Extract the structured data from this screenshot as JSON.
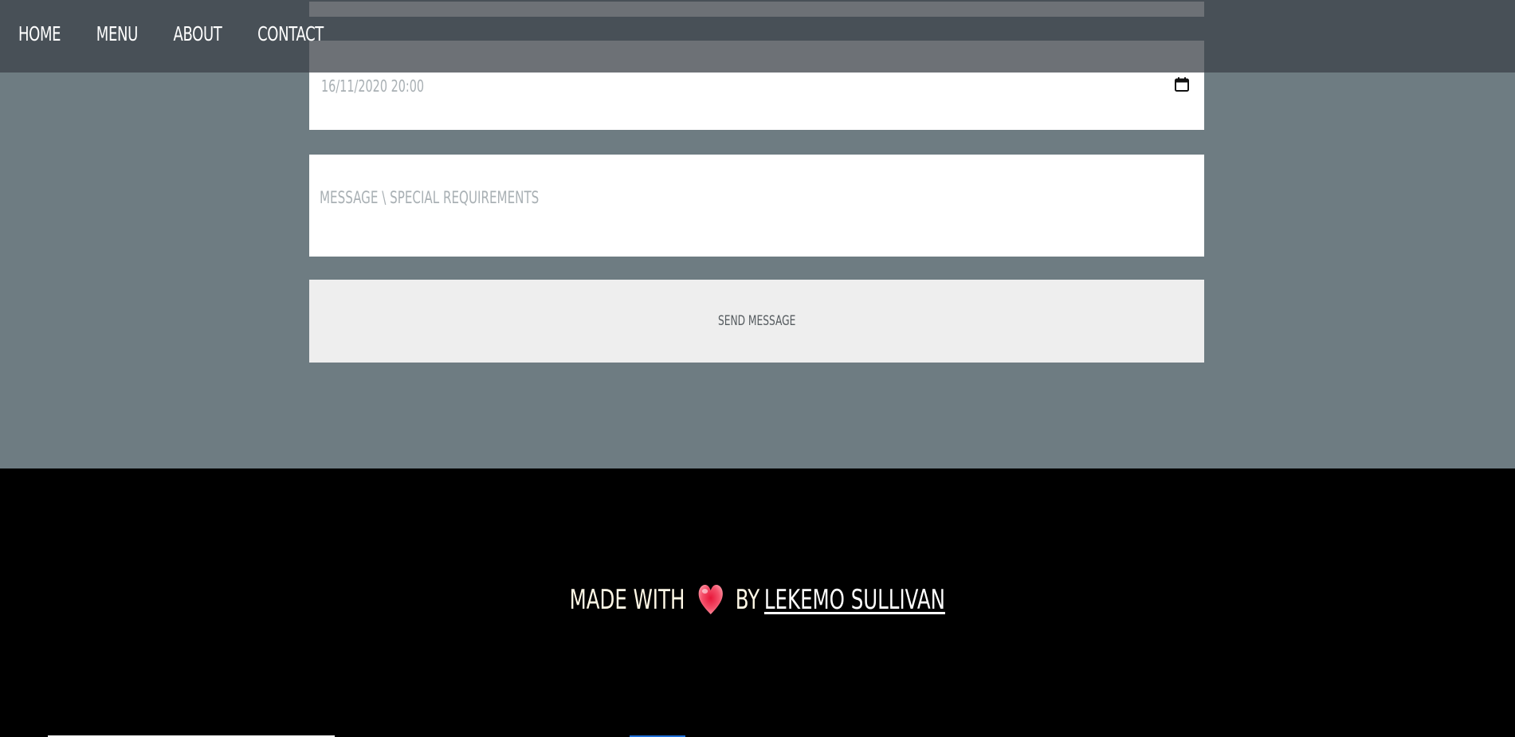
{
  "nav": {
    "items": [
      {
        "label": "HOME"
      },
      {
        "label": "MENU"
      },
      {
        "label": "ABOUT"
      },
      {
        "label": "CONTACT"
      }
    ]
  },
  "form": {
    "date_value": "16/11/2020 20:00",
    "message_placeholder": "MESSAGE \\ SPECIAL REQUIREMENTS",
    "send_label": "SEND MESSAGE",
    "calendar_icon": "calendar-icon"
  },
  "footer": {
    "made_with": "MADE WITH",
    "heart_icon": "heart-icon",
    "by": "BY",
    "author": "LEKEMO SULLIVAN"
  },
  "colors": {
    "page_background": "#6e7c82",
    "nav_background": "#4b5359",
    "footer_background": "#000000",
    "button_background": "#eeeeee",
    "footer_text": "#fff8e6",
    "heart": "#f0405a"
  }
}
